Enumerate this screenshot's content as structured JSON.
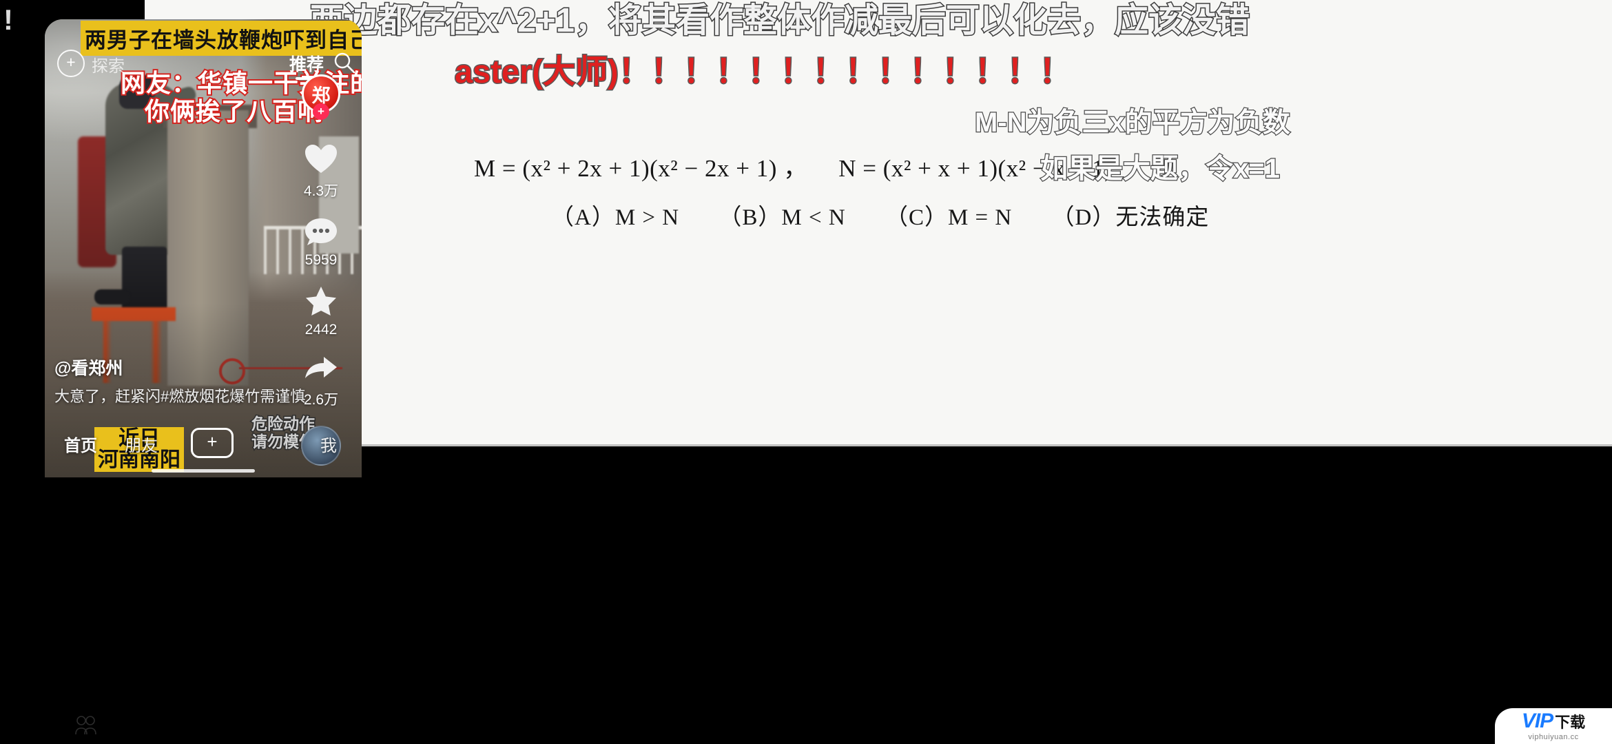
{
  "document": {
    "equation_m": "M = (x² + 2x + 1)(x² − 2x + 1) ，",
    "equation_n": "N = (x² + x + 1)(x² − x + 1)",
    "choices": [
      {
        "label": "（A）",
        "text": "M > N"
      },
      {
        "label": "（B）",
        "text": "M < N"
      },
      {
        "label": "（C）",
        "text": "M = N"
      },
      {
        "label": "（D）",
        "text": "无法确定"
      }
    ]
  },
  "danmaku": [
    {
      "id": "dm-top",
      "text": "两边都存在x^2+1，将其看作整体作减最后可以化去，应该没错"
    },
    {
      "id": "dm-master",
      "text": "aster(大师)！！！！！！！！！！！！！！"
    },
    {
      "id": "dm-mn",
      "text": "M-N为负三x的平方为负数"
    },
    {
      "id": "dm-bigproblem",
      "text": "如果是大题，令x=1"
    }
  ],
  "phone": {
    "topbar": {
      "plus_icon": "plus-circle-icon",
      "explore_label": "探索",
      "recommend_label": "推荐",
      "search_icon": "search-icon"
    },
    "video_overlays": {
      "headline_banner": "两男子在墙头放鞭炮吓到自己",
      "red_line_1": "网友：华镇一干关注的商城",
      "red_line_2": "你俩挨了八百响",
      "bottom_banner_line1": "近日",
      "bottom_banner_line2": "河南南阳",
      "warning_line1": "危险动作",
      "warning_line2": "请勿模仿"
    },
    "rail": {
      "avatar_initial": "郑",
      "follow_badge": "+",
      "items": [
        {
          "icon": "heart-icon",
          "name": "like-button",
          "count": "4.3万"
        },
        {
          "icon": "comment-icon",
          "name": "comment-button",
          "count": "5959"
        },
        {
          "icon": "star-icon",
          "name": "favorite-button",
          "count": "2442"
        },
        {
          "icon": "share-icon",
          "name": "share-button",
          "count": "2.6万"
        }
      ],
      "music_disc": "music-disc-icon"
    },
    "author": "@看郑州",
    "caption": "大意了，赶紧闪#燃放烟花爆竹需谨慎",
    "bottomnav": {
      "home": "首页",
      "friends": "朋友",
      "create_icon": "plus-square-icon",
      "me": "我"
    }
  },
  "chrome": {
    "corner_mark": "!",
    "contacts_icon": "contacts-icon"
  },
  "watermark": {
    "brand": "VIP",
    "suffix": "下载",
    "url": "viphuiyuan.cc"
  },
  "colors": {
    "accent_red": "#fe2c55",
    "brand_blue": "#1a7bff",
    "banner_yellow": "#e9c01c",
    "danmaku_red": "#e02020"
  }
}
